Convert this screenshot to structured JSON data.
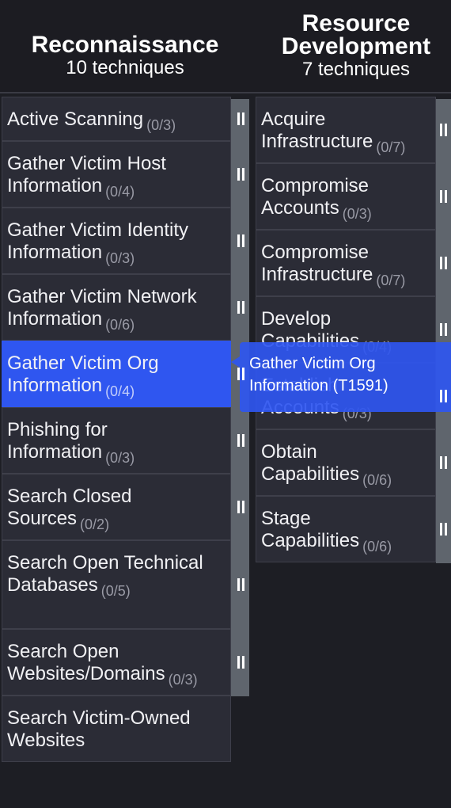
{
  "tactics": [
    {
      "name": "Reconnaissance",
      "count_label": "10 techniques",
      "techniques": [
        {
          "name": "Active Scanning",
          "count": "(0/3)"
        },
        {
          "name": "Gather Victim Host Information",
          "count": "(0/4)"
        },
        {
          "name": "Gather Victim Identity Information",
          "count": "(0/3)"
        },
        {
          "name": "Gather Victim Network Information",
          "count": "(0/6)"
        },
        {
          "name": "Gather Victim Org Information",
          "count": "(0/4)"
        },
        {
          "name": "Phishing for Information",
          "count": "(0/3)"
        },
        {
          "name": "Search Closed Sources",
          "count": "(0/2)"
        },
        {
          "name": "Search Open Technical Databases",
          "count": "(0/5)"
        },
        {
          "name": "Search Open Websites/Domains",
          "count": "(0/3)"
        },
        {
          "name": "Search Victim-Owned Websites",
          "count": ""
        }
      ]
    },
    {
      "name": "Resource Development",
      "count_label": "7 techniques",
      "techniques": [
        {
          "name": "Acquire Infrastructure",
          "count": "(0/7)"
        },
        {
          "name": "Compromise Accounts",
          "count": "(0/3)"
        },
        {
          "name": "Compromise Infrastructure",
          "count": "(0/7)"
        },
        {
          "name": "Develop Capabilities",
          "count": "(0/4)"
        },
        {
          "name": "Establish Accounts",
          "count": "(0/3)"
        },
        {
          "name": "Obtain Capabilities",
          "count": "(0/6)"
        },
        {
          "name": "Stage Capabilities",
          "count": "(0/6)"
        }
      ]
    }
  ],
  "selected_technique": "Gather Victim Org Information",
  "tooltip": {
    "text": "Gather Victim Org Information (T1591)"
  },
  "colors": {
    "background": "#1d1e24",
    "cell": "#2b2c36",
    "selected": "#2f56f0",
    "handle": "#5f656d"
  },
  "icons": {
    "expand_handle": "drag-handle-icon"
  }
}
